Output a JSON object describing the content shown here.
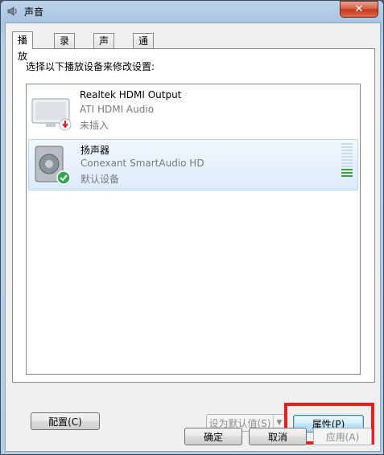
{
  "window": {
    "title": "声音",
    "close_label": "✕"
  },
  "tabs": [
    {
      "label": "播放",
      "active": true
    },
    {
      "label": "录制",
      "active": false
    },
    {
      "label": "声音",
      "active": false
    },
    {
      "label": "通信",
      "active": false
    }
  ],
  "instruction": "选择以下播放设备来修改设置:",
  "devices": [
    {
      "name": "Realtek HDMI Output",
      "driver": "ATI HDMI Audio",
      "status": "未插入",
      "icon": "monitor-icon",
      "badge": "unplugged-icon"
    },
    {
      "name": "扬声器",
      "driver": "Conexant SmartAudio HD",
      "status": "默认设备",
      "icon": "speaker-icon",
      "badge": "default-check-icon",
      "selected": true,
      "level": 0.2
    }
  ],
  "buttons": {
    "configure": "配置(C)",
    "set_default": "设为默认值(S)",
    "properties": "属性(P)",
    "ok": "确定",
    "cancel": "取消",
    "apply": "应用(A)"
  },
  "colors": {
    "highlight": "#ee1c1c",
    "level_on": "#39a33b"
  }
}
